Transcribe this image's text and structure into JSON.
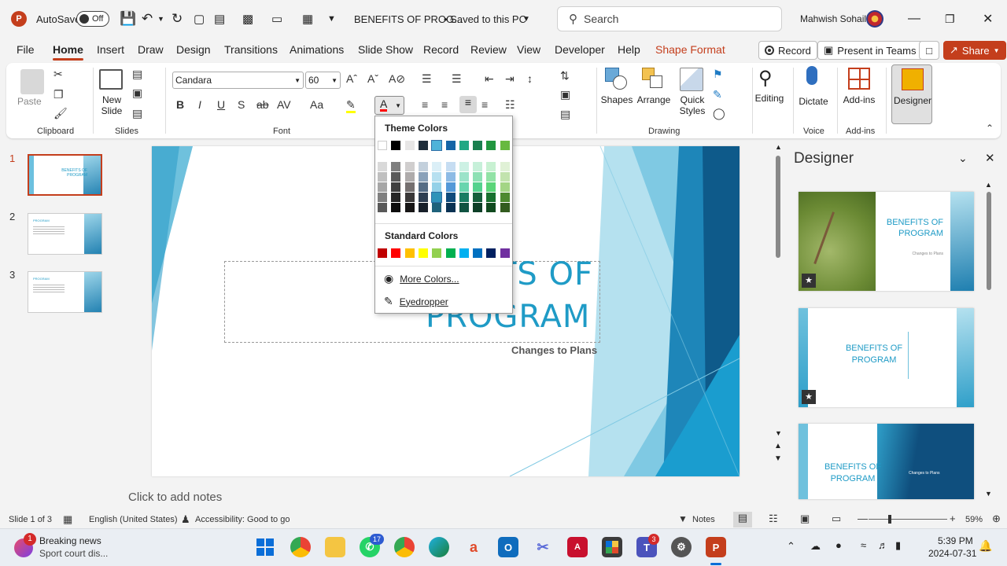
{
  "titlebar": {
    "autosave_label": "AutoSave",
    "autosave_state": "Off",
    "doc_title": "BENEFITS OF PROG...",
    "save_status": "• Saved to this PC",
    "search_placeholder": "Search",
    "user_name": "Mahwish Sohail"
  },
  "menu": {
    "items": [
      "File",
      "Home",
      "Insert",
      "Draw",
      "Design",
      "Transitions",
      "Animations",
      "Slide Show",
      "Record",
      "Review",
      "View",
      "Developer",
      "Help",
      "Shape Format"
    ],
    "active": "Home",
    "record_btn": "Record",
    "present_btn": "Present in Teams",
    "share_btn": "Share"
  },
  "ribbon": {
    "clipboard": {
      "paste": "Paste",
      "label": "Clipboard"
    },
    "slides": {
      "new_slide": "New Slide",
      "label": "Slides"
    },
    "font": {
      "name": "Candara",
      "size": "60",
      "label": "Font"
    },
    "drawing": {
      "shapes": "Shapes",
      "arrange": "Arrange",
      "quick_styles": "Quick Styles",
      "label": "Drawing"
    },
    "editing": {
      "label": "Editing"
    },
    "voice": {
      "dictate": "Dictate",
      "label": "Voice"
    },
    "addins": {
      "addins": "Add-ins",
      "label": "Add-ins"
    },
    "designer": {
      "label": "Designer"
    }
  },
  "color_popup": {
    "theme_title": "Theme Colors",
    "standard_title": "Standard Colors",
    "more_colors": "More Colors...",
    "eyedropper": "Eyedropper",
    "theme_top": [
      "#ffffff",
      "#000000",
      "#e7e6e6",
      "#1f2d3a",
      "#4fb3d9",
      "#1565a6",
      "#22a784",
      "#1b7f4f",
      "#21963f",
      "#67b93f"
    ],
    "theme_columns": [
      [
        "#d9d9d9",
        "#bfbfbf",
        "#a6a6a6",
        "#808080",
        "#595959"
      ],
      [
        "#7f7f7f",
        "#595959",
        "#3f3f3f",
        "#262626",
        "#0d0d0d"
      ],
      [
        "#d0cece",
        "#aeabab",
        "#757070",
        "#3a3838",
        "#171616"
      ],
      [
        "#c3d0dc",
        "#8aa1b9",
        "#566d86",
        "#2f3f52",
        "#18202a"
      ],
      [
        "#dbeff7",
        "#b7e0f0",
        "#94d1e8",
        "#2f93b9",
        "#1f627b"
      ],
      [
        "#c6ddf2",
        "#8dbbe5",
        "#5499d8",
        "#104b7c",
        "#0a3253"
      ],
      [
        "#cdf1e4",
        "#9be3c9",
        "#69d5ae",
        "#197d63",
        "#105342"
      ],
      [
        "#c6f0d9",
        "#8de1b4",
        "#54d28e",
        "#145f3b",
        "#0d3f27"
      ],
      [
        "#c8f1d2",
        "#92e3a6",
        "#5bd579",
        "#18702f",
        "#104a1f"
      ],
      [
        "#e0f1d6",
        "#c2e3ae",
        "#a3d585",
        "#4d8a2f",
        "#335c1f"
      ]
    ],
    "standard": [
      "#c00000",
      "#ff0000",
      "#ffc000",
      "#ffff00",
      "#92d050",
      "#00b050",
      "#00b0f0",
      "#0070c0",
      "#002060",
      "#7030a0"
    ]
  },
  "slide": {
    "title_line1": "BENEFITS OF",
    "title_visible": "TS OF",
    "title_line2": "PROGRAM",
    "subtitle": "Changes to Plans"
  },
  "thumbnails": [
    {
      "num": "1",
      "title": "BENEFITS OF PROGRAM"
    },
    {
      "num": "2",
      "title": "PROGRAM"
    },
    {
      "num": "3",
      "title": "PROGRAM"
    }
  ],
  "notes_placeholder": "Click to add notes",
  "designer": {
    "title": "Designer",
    "cards": [
      {
        "title": "BENEFITS OF PROGRAM",
        "subtitle": "Changes to Plans"
      },
      {
        "title": "BENEFITS OF PROGRAM",
        "subtitle": ""
      },
      {
        "title": "BENEFITS OF PROGRAM",
        "subtitle": "Changes to Plans"
      }
    ]
  },
  "status": {
    "slide_count": "Slide 1 of 3",
    "language": "English (United States)",
    "accessibility": "Accessibility: Good to go",
    "notes": "Notes",
    "zoom": "59%"
  },
  "taskbar": {
    "news_title": "Breaking news",
    "news_sub": "Sport court dis...",
    "news_badge": "1",
    "whatsapp_badge": "17",
    "teams_badge": "3",
    "time": "5:39 PM",
    "date": "2024-07-31"
  },
  "colors": {
    "accent": "#c43e1c",
    "slide_blue": "#1f9bc6"
  }
}
